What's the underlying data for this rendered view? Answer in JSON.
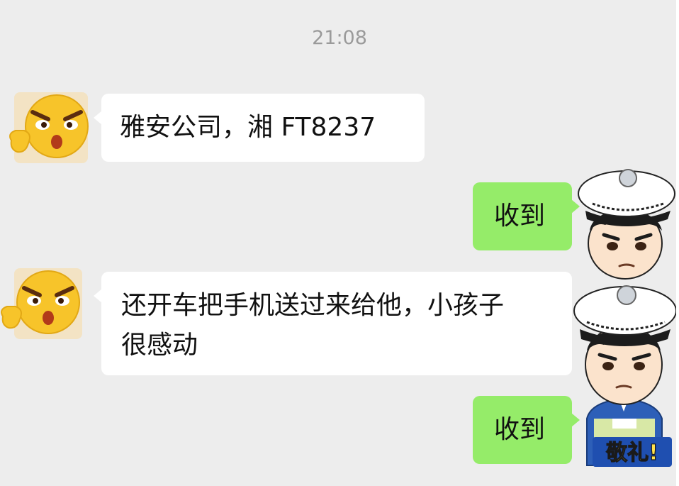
{
  "chat": {
    "timestamp": "21:08",
    "messages": [
      {
        "side": "left",
        "text": "雅安公司，湘 FT8237",
        "avatar_icon": "angry-emoji-avatar-icon"
      },
      {
        "side": "right",
        "text": "收到",
        "avatar_icon": "police-officer-avatar-icon"
      },
      {
        "side": "left",
        "text_line1": "还开车把手机送过来给他，小孩子",
        "text_line2": "很感动",
        "avatar_icon": "angry-emoji-avatar-icon"
      },
      {
        "side": "right",
        "text": "收到",
        "avatar_icon": "police-salute-sticker-icon",
        "sticker_text": "敬礼!"
      }
    ]
  },
  "colors": {
    "background": "#ededed",
    "incoming_bubble": "#ffffff",
    "outgoing_bubble": "#95ec69",
    "timestamp_text": "#9a9a9a"
  }
}
